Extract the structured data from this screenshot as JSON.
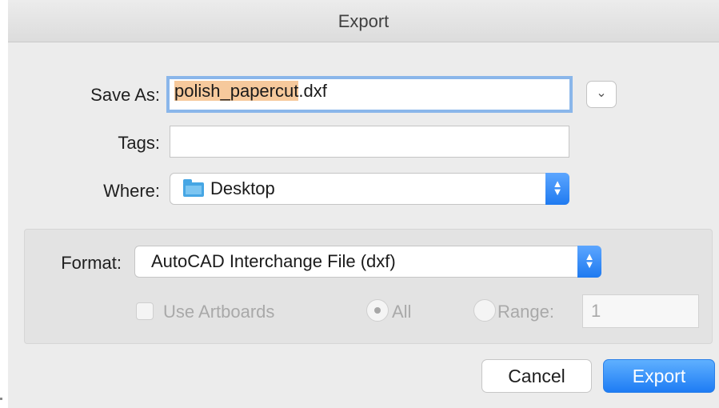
{
  "window": {
    "title": "Export"
  },
  "save": {
    "label": "Save As:",
    "filename_base": "polish_papercut",
    "filename_ext": ".dxf"
  },
  "tags": {
    "label": "Tags:",
    "value": ""
  },
  "where": {
    "label": "Where:",
    "value": "Desktop",
    "icon": "folder-icon"
  },
  "format": {
    "label": "Format:",
    "value": "AutoCAD Interchange File (dxf)"
  },
  "artboards": {
    "use_label": "Use Artboards",
    "use_checked": false,
    "all_label": "All",
    "range_label": "Range:",
    "range_value": "1",
    "selected": "All",
    "enabled": false
  },
  "buttons": {
    "cancel": "Cancel",
    "export": "Export"
  },
  "colors": {
    "accent": "#1e7cf4",
    "selection": "#f6c99c",
    "focus_ring": "#8ab6ea"
  },
  "icons": {
    "disclosure": "chevron-down-icon",
    "popup_stepper": "updown-arrows-icon"
  }
}
